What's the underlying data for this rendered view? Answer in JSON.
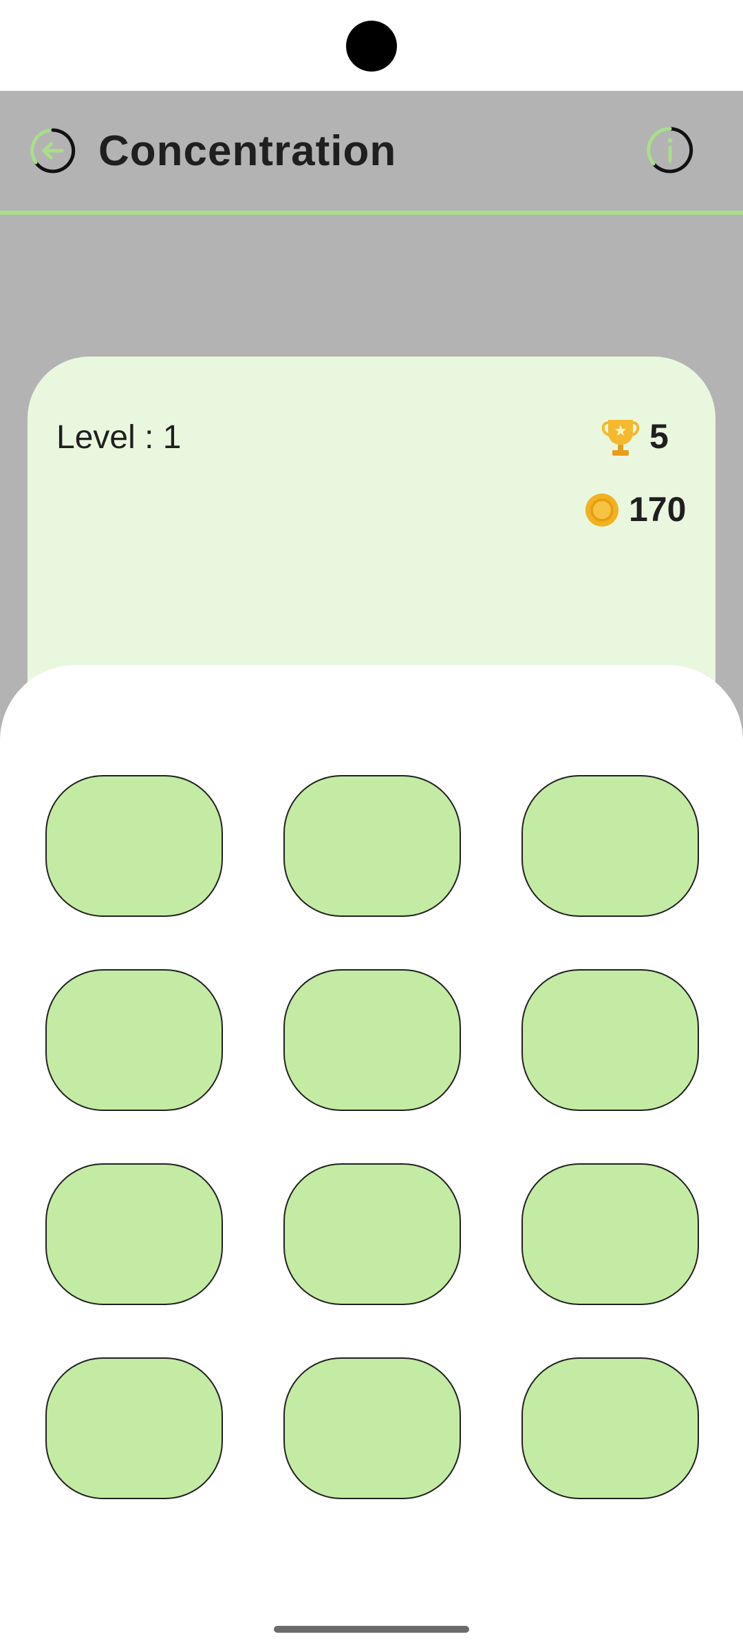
{
  "app_bar": {
    "title": "Concentration",
    "back_icon": "back-arrow-circle-icon",
    "info_icon": "info-circle-icon",
    "accent_color": "#a8df88"
  },
  "stats": {
    "level_text": "Level : 1",
    "trophies": "5",
    "coins": "170",
    "trophy_icon": "trophy-icon",
    "coin_icon": "coin-icon"
  },
  "board": {
    "rows": 4,
    "columns": 3,
    "card_state": "face-down",
    "card_color": "#c3eba3"
  }
}
